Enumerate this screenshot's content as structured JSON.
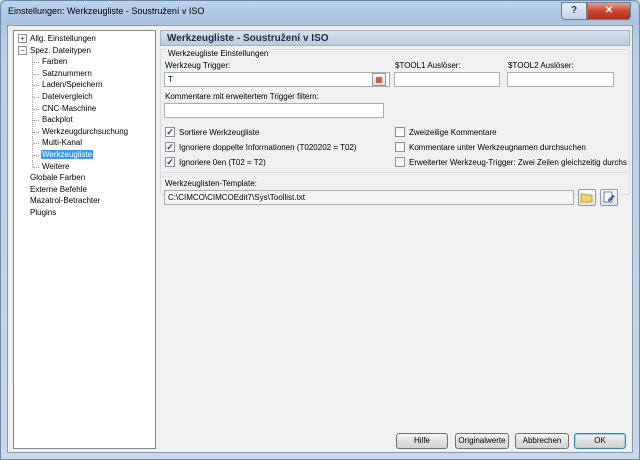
{
  "window": {
    "title": "Einstellungen: Werkzeugliste - Soustružení v ISO",
    "help_label": "?",
    "close_label": "✕"
  },
  "tree": {
    "items": [
      {
        "label": "Allg. Einstellungen",
        "level": 0,
        "expander": "+"
      },
      {
        "label": "Spez. Dateitypen",
        "level": 0,
        "expander": "−"
      },
      {
        "label": "Farben",
        "level": 1
      },
      {
        "label": "Satznummern",
        "level": 1
      },
      {
        "label": "Laden/Speichern",
        "level": 1
      },
      {
        "label": "Dateivergleich",
        "level": 1
      },
      {
        "label": "CNC-Maschine",
        "level": 1
      },
      {
        "label": "Backplot",
        "level": 1
      },
      {
        "label": "Werkzeugdurchsuchung",
        "level": 1
      },
      {
        "label": "Multi-Kanal",
        "level": 1
      },
      {
        "label": "Werkzeugliste",
        "level": 1,
        "selected": true
      },
      {
        "label": "Weitere",
        "level": 1
      },
      {
        "label": "Globale Farben",
        "level": 0
      },
      {
        "label": "Externe Befehle",
        "level": 0
      },
      {
        "label": "Mazatrol-Betrachter",
        "level": 0
      },
      {
        "label": "Plugins",
        "level": 0
      }
    ]
  },
  "panel": {
    "title": "Werkzeugliste - Soustružení v ISO",
    "group_title": "Werkzeugliste Einstellungen",
    "trigger_label": "Werkzeug Trigger:",
    "trigger_value": "T",
    "tool1_label": "$TOOL1 Auslöser:",
    "tool1_value": "",
    "tool2_label": "$TOOL2 Auslöser:",
    "tool2_value": "",
    "comment_filter_label": "Kommentare mit erweitertem Trigger filtern:",
    "comment_filter_value": "",
    "checkboxes_left": [
      {
        "label": "Sortiere Werkzeugliste",
        "checked": true
      },
      {
        "label": "Ignoriere doppelte Informationen (T020202 = T02)",
        "checked": true
      },
      {
        "label": "Ignoriere 0en (T02 = T2)",
        "checked": true
      }
    ],
    "checkboxes_right": [
      {
        "label": "Zweizeilige Kommentare",
        "checked": false
      },
      {
        "label": "Kommentare unter Werkzeugnamen durchsuchen",
        "checked": false
      },
      {
        "label": "Erweiterter Werkzeug-Trigger: Zwei Zeilen gleichzeitig durchs",
        "checked": false
      }
    ],
    "template_label": "Werkzeuglisten-Template:",
    "template_value": "C:\\CIMCO\\CIMCOEdit7\\Sys\\Toollist.txt",
    "check_mark": "✓"
  },
  "buttons": {
    "help": "Hilfe",
    "defaults": "Originalwerte",
    "cancel": "Abbrechen",
    "ok": "OK"
  }
}
